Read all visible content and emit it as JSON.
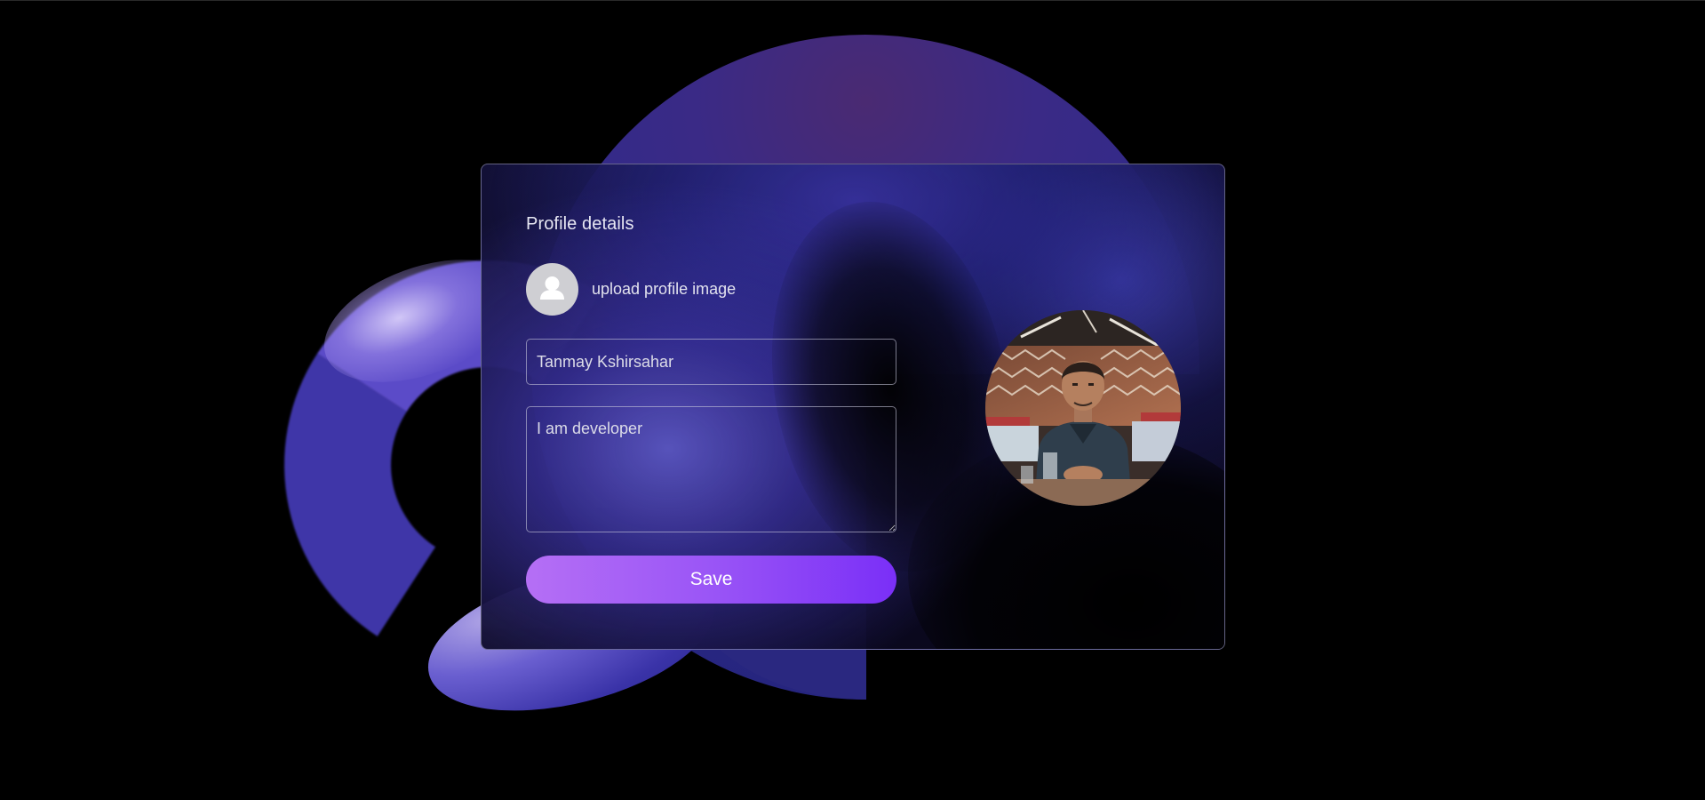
{
  "profile": {
    "title": "Profile details",
    "upload_label": "upload profile image",
    "avatar_icon": "user-icon",
    "name_value": "Tanmay Kshirsahar",
    "bio_value": "I am developer",
    "save_label": "Save",
    "photo_icon": "profile-photo"
  },
  "colors": {
    "background": "#000000",
    "save_gradient_start": "#b56ff5",
    "save_gradient_end": "#7a2ff7",
    "blob_primary": "#2e2a8a"
  }
}
